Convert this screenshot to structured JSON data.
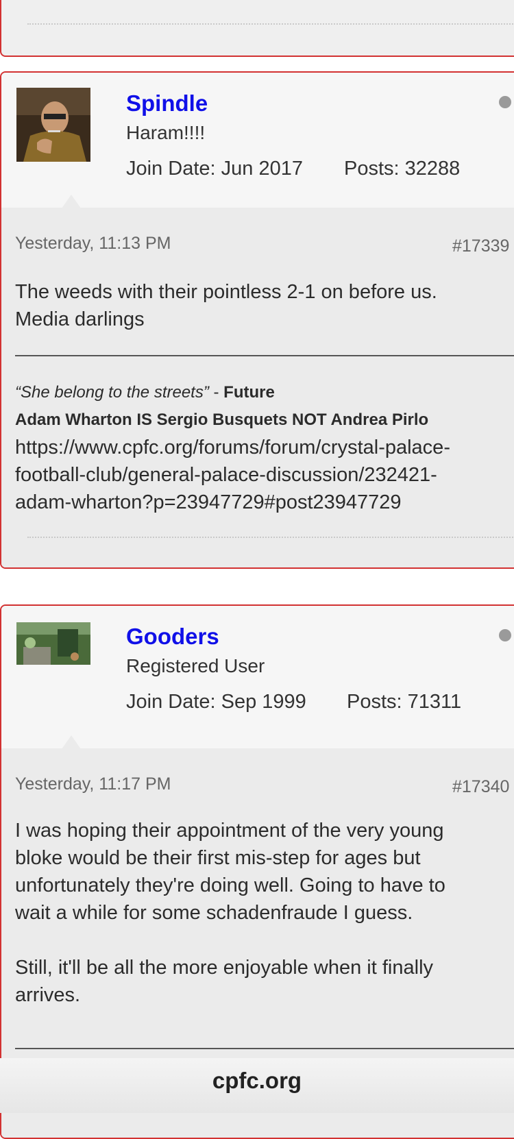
{
  "posts": [
    {
      "username": "Spindle",
      "usertitle": "Haram!!!!",
      "join_date": "Join Date: Jun 2017",
      "posts_count": "Posts: 32288",
      "date": "Yesterday, 11:13 PM",
      "post_number": "#17339",
      "message": [
        "The weeds with their pointless 2-1 on before us.",
        "Media darlings"
      ],
      "signature": {
        "quote": "“She belong to the streets”",
        "dash": " - ",
        "author": "Future",
        "bold_line": "Adam Wharton IS Sergio Busquets NOT Andrea Pirlo",
        "link_lines": [
          "https://www.cpfc.org/forums/forum/crystal-palace-",
          "football-club/general-palace-discussion/232421-",
          "adam-wharton?p=23947729#post23947729"
        ]
      }
    },
    {
      "username": "Gooders",
      "usertitle": "Registered User",
      "join_date": "Join Date: Sep 1999",
      "posts_count": "Posts: 71311",
      "date": "Yesterday, 11:17 PM",
      "post_number": "#17340",
      "message": [
        "I was hoping their appointment of the very young",
        "bloke would be their first mis-step for ages but",
        "unfortunately they're doing well. Going to have to",
        "wait a while for some schadenfraude I guess.",
        "",
        "Still, it'll be all the more enjoyable when it finally",
        "arrives."
      ]
    }
  ],
  "browser": {
    "domain": "cpfc.org"
  },
  "icons": {
    "status": "offline-status-icon",
    "avatar1": "avatar-icon",
    "avatar2": "avatar-icon"
  }
}
